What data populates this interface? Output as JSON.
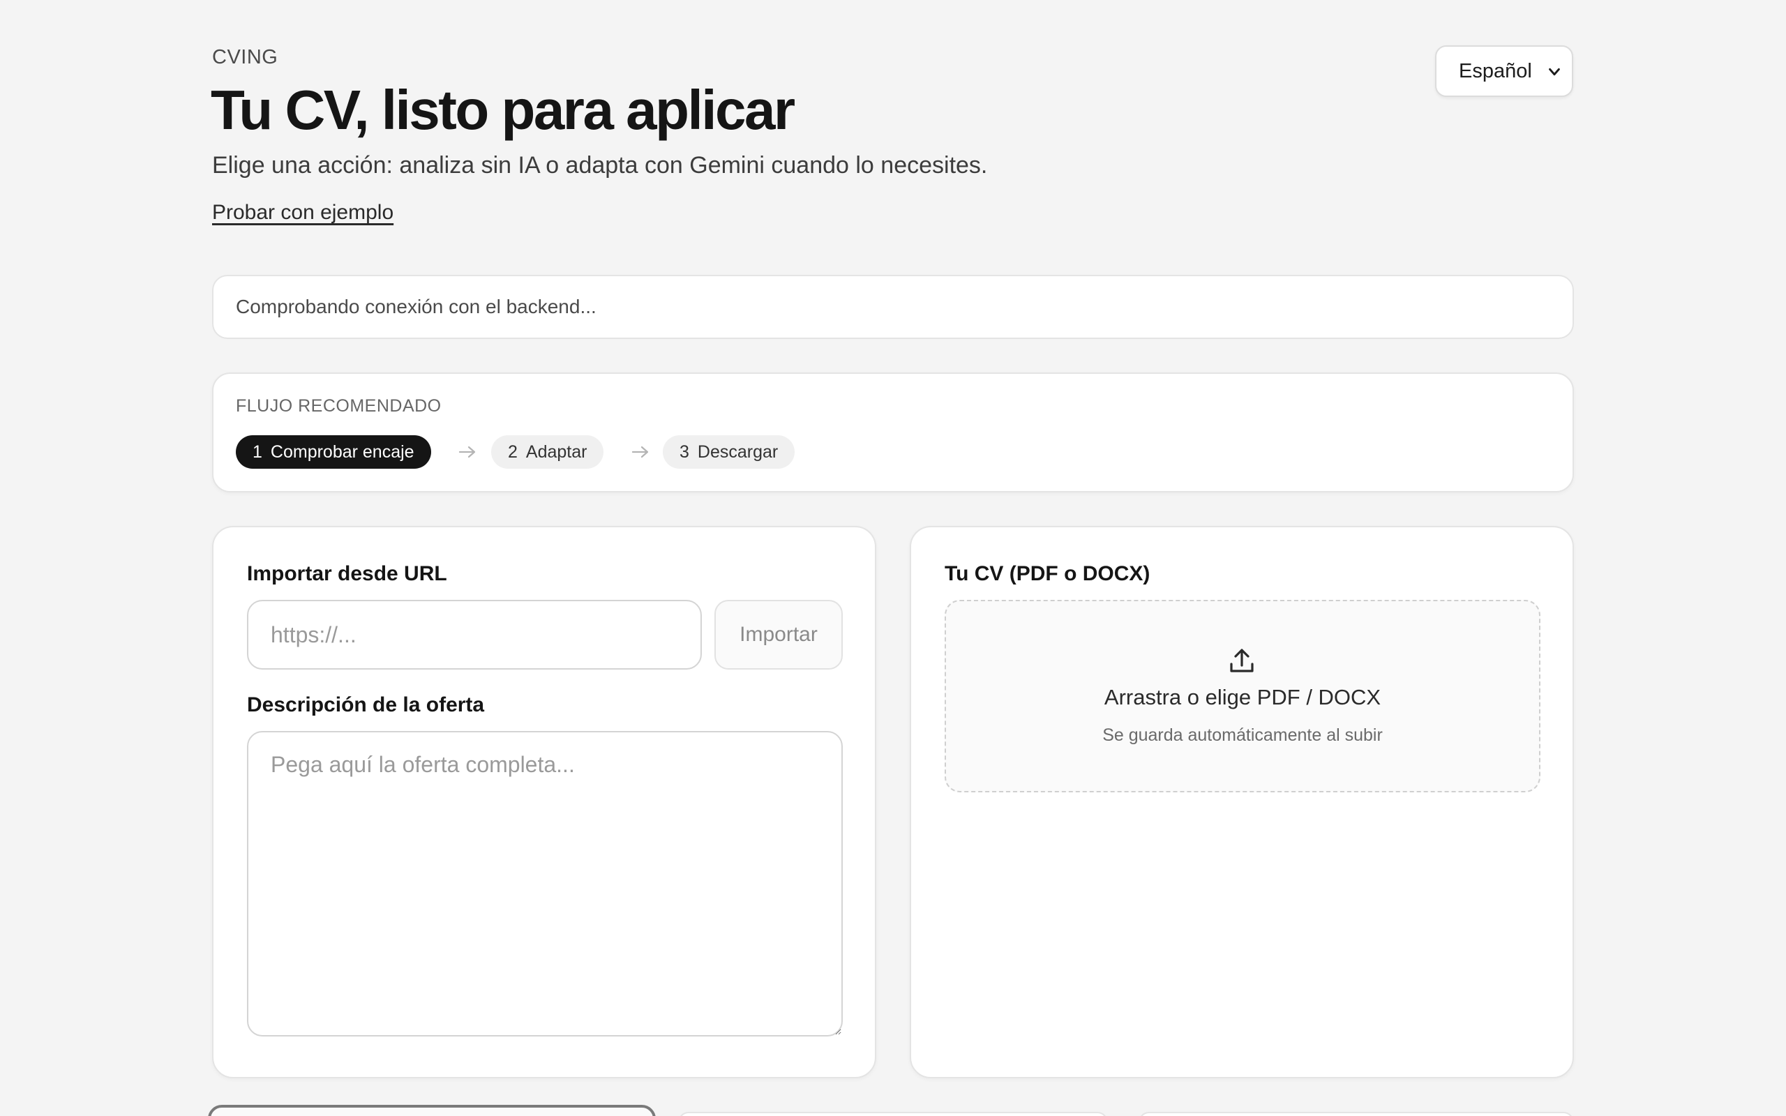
{
  "header": {
    "brand": "CVING",
    "title": "Tu CV, listo para aplicar",
    "subtitle": "Elige una acción: analiza sin IA o adapta con Gemini cuando lo necesites.",
    "example_link": "Probar con ejemplo",
    "language": {
      "selected": "Español",
      "icon": "chevron-down-icon"
    }
  },
  "status": {
    "message": "Comprobando conexión con el backend..."
  },
  "flow": {
    "heading": "FLUJO RECOMENDADO",
    "steps": [
      {
        "number": "1",
        "label": "Comprobar encaje",
        "active": true
      },
      {
        "number": "2",
        "label": "Adaptar",
        "active": false
      },
      {
        "number": "3",
        "label": "Descargar",
        "active": false
      }
    ],
    "separator_icon": "arrow-right-icon"
  },
  "job_panel": {
    "url_label": "Importar desde URL",
    "url_value": "",
    "url_placeholder": "https://...",
    "import_button": "Importar",
    "description_label": "Descripción de la oferta",
    "description_value": "",
    "description_placeholder": "Pega aquí la oferta completa..."
  },
  "cv_panel": {
    "label": "Tu CV (PDF o DOCX)",
    "dropzone_icon": "upload-icon",
    "dropzone_title": "Arrastra o elige PDF / DOCX",
    "dropzone_subtitle": "Se guarda automáticamente al subir"
  },
  "colors": {
    "background": "#f4f4f4",
    "card": "#ffffff",
    "active_step": "#151515",
    "inactive_step": "#f0f0f0",
    "text_primary": "#151515",
    "text_muted": "#6a6a6a"
  }
}
